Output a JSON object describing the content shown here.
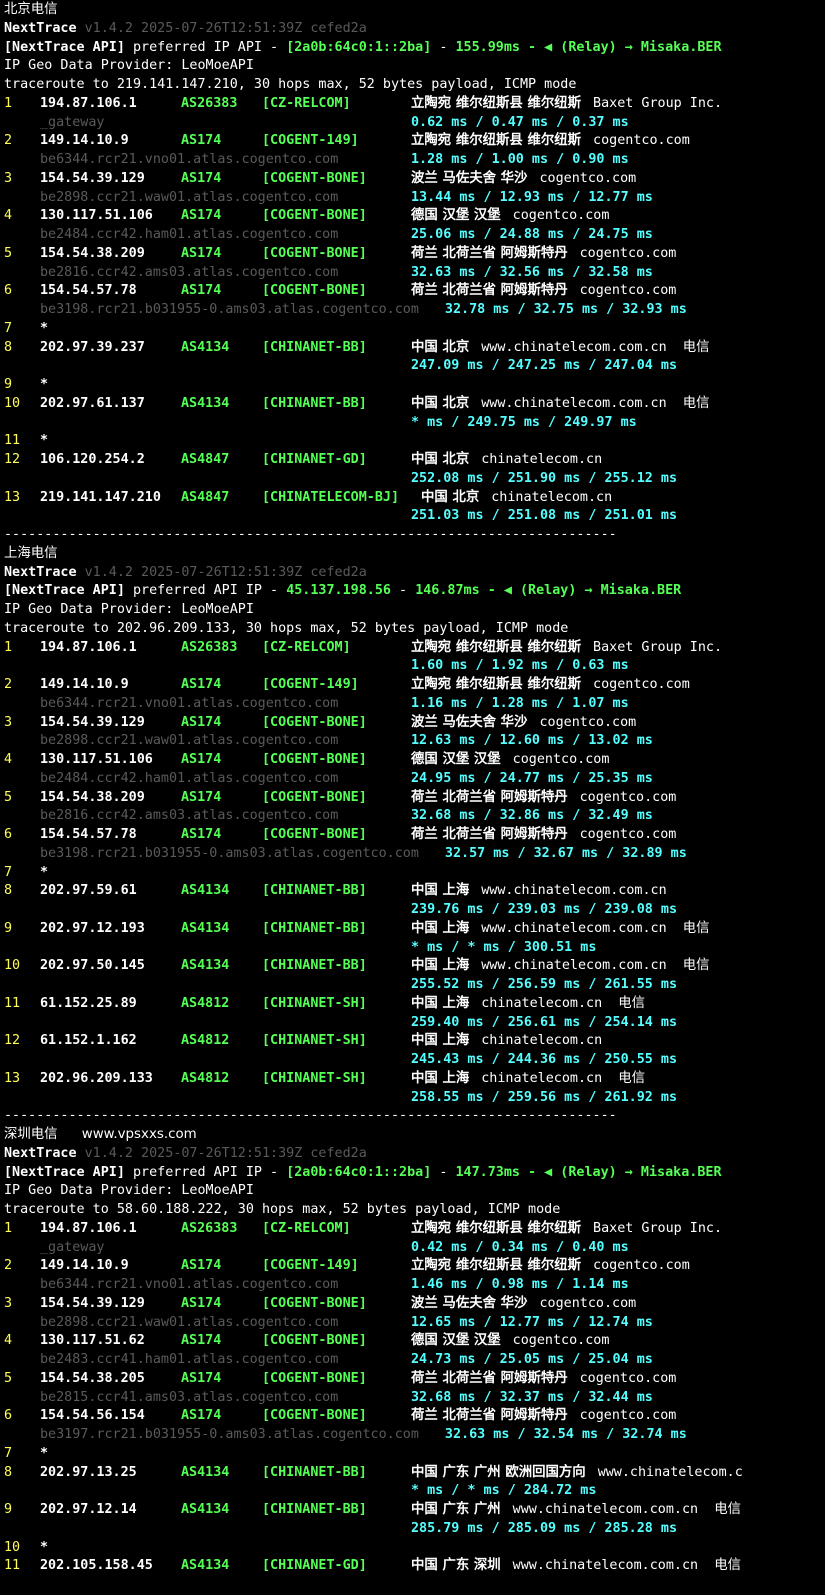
{
  "sections": [
    {
      "label": "北京电信",
      "header": {
        "name": "NextTrace",
        "version": "v1.4.2 2025-07-26T12:51:39Z cefed2a",
        "api_prefix": "[NextTrace API]",
        "api_text": " preferred IP API - ",
        "api_ip": "[2a0b:64c0:1::2ba]",
        "api_dash": " - ",
        "api_latency": "155.99ms",
        "api_relay": " - ◀ (Relay) → Misaka.BER",
        "geo": "IP Geo Data Provider: LeoMoeAPI",
        "trace": "traceroute to 219.141.147.210, 30 hops max, 52 bytes payload, ICMP mode"
      },
      "hops": [
        {
          "n": "1",
          "ip": "194.87.106.1",
          "as": "AS26383",
          "tag": "[CZ-RELCOM]",
          "geo": "立陶宛 维尔纽斯县 维尔纽斯",
          "org": "Baxet Group Inc.",
          "host": "_gateway",
          "rtt": "0.62 ms / 0.47 ms / 0.37 ms"
        },
        {
          "n": "2",
          "ip": "149.14.10.9",
          "as": "AS174",
          "tag": "[COGENT-149]",
          "geo": "立陶宛 维尔纽斯县 维尔纽斯",
          "org": "cogentco.com",
          "host": "be6344.rcr21.vno01.atlas.cogentco.com",
          "rtt": "1.28 ms / 1.00 ms / 0.90 ms"
        },
        {
          "n": "3",
          "ip": "154.54.39.129",
          "as": "AS174",
          "tag": "[COGENT-BONE]",
          "geo": "波兰 马佐夫舍 华沙",
          "org": "cogentco.com",
          "host": "be2898.ccr21.waw01.atlas.cogentco.com",
          "rtt": "13.44 ms / 12.93 ms / 12.77 ms"
        },
        {
          "n": "4",
          "ip": "130.117.51.106",
          "as": "AS174",
          "tag": "[COGENT-BONE]",
          "geo": "德国 汉堡 汉堡",
          "org": "cogentco.com",
          "host": "be2484.ccr42.ham01.atlas.cogentco.com",
          "rtt": "25.06 ms / 24.88 ms / 24.75 ms"
        },
        {
          "n": "5",
          "ip": "154.54.38.209",
          "as": "AS174",
          "tag": "[COGENT-BONE]",
          "geo": "荷兰 北荷兰省 阿姆斯特丹",
          "org": "cogentco.com",
          "host": "be2816.ccr42.ams03.atlas.cogentco.com",
          "rtt": "32.63 ms / 32.56 ms / 32.58 ms"
        },
        {
          "n": "6",
          "ip": "154.54.57.78",
          "as": "AS174",
          "tag": "[COGENT-BONE]",
          "geo": "荷兰 北荷兰省 阿姆斯特丹",
          "org": "cogentco.com",
          "host": "be3198.rcr21.b031955-0.ams03.atlas.cogentco.com",
          "rtt": "32.78 ms / 32.75 ms / 32.93 ms",
          "inline": true
        },
        {
          "n": "7",
          "star": true
        },
        {
          "n": "8",
          "ip": "202.97.39.237",
          "as": "AS4134",
          "tag": "[CHINANET-BB]",
          "geo": "中国 北京",
          "org": "www.chinatelecom.com.cn",
          "isp": "电信",
          "rtt": "247.09 ms / 247.25 ms / 247.04 ms"
        },
        {
          "n": "9",
          "star": true
        },
        {
          "n": "10",
          "ip": "202.97.61.137",
          "as": "AS4134",
          "tag": "[CHINANET-BB]",
          "geo": "中国 北京",
          "org": "www.chinatelecom.com.cn",
          "isp": "电信",
          "rtt": "* ms / 249.75 ms / 249.97 ms"
        },
        {
          "n": "11",
          "star": true
        },
        {
          "n": "12",
          "ip": "106.120.254.2",
          "as": "AS4847",
          "tag": "[CHINANET-GD]",
          "geo": "中国 北京",
          "org": "chinatelecom.cn",
          "rtt": "252.08 ms / 251.90 ms / 255.12 ms"
        },
        {
          "n": "13",
          "ip": "219.141.147.210",
          "as": "AS4847",
          "tag": "[CHINATELECOM-BJ]",
          "geo": "中国 北京",
          "org": "chinatelecom.cn",
          "rtt": "251.03 ms / 251.08 ms / 251.01 ms",
          "wide": true
        }
      ],
      "divider": "----------------------------------------------------------------------------"
    },
    {
      "label": "上海电信",
      "header": {
        "name": "NextTrace",
        "version": "v1.4.2 2025-07-26T12:51:39Z cefed2a",
        "api_prefix": "[NextTrace API]",
        "api_text": " preferred API IP - ",
        "api_ip": "45.137.198.56",
        "api_dash": " - ",
        "api_latency": "146.87ms",
        "api_relay": " - ◀ (Relay) → Misaka.BER",
        "geo": "IP Geo Data Provider: LeoMoeAPI",
        "trace": "traceroute to 202.96.209.133, 30 hops max, 52 bytes payload, ICMP mode"
      },
      "hops": [
        {
          "n": "1",
          "ip": "194.87.106.1",
          "as": "AS26383",
          "tag": "[CZ-RELCOM]",
          "geo": "立陶宛 维尔纽斯县 维尔纽斯",
          "org": "Baxet Group Inc.",
          "rtt": "1.60 ms / 1.92 ms / 0.63 ms"
        },
        {
          "n": "2",
          "ip": "149.14.10.9",
          "as": "AS174",
          "tag": "[COGENT-149]",
          "geo": "立陶宛 维尔纽斯县 维尔纽斯",
          "org": "cogentco.com",
          "host": "be6344.rcr21.vno01.atlas.cogentco.com",
          "rtt": "1.16 ms / 1.28 ms / 1.07 ms"
        },
        {
          "n": "3",
          "ip": "154.54.39.129",
          "as": "AS174",
          "tag": "[COGENT-BONE]",
          "geo": "波兰 马佐夫舍 华沙",
          "org": "cogentco.com",
          "host": "be2898.ccr21.waw01.atlas.cogentco.com",
          "rtt": "12.63 ms / 12.60 ms / 13.02 ms"
        },
        {
          "n": "4",
          "ip": "130.117.51.106",
          "as": "AS174",
          "tag": "[COGENT-BONE]",
          "geo": "德国 汉堡 汉堡",
          "org": "cogentco.com",
          "host": "be2484.ccr42.ham01.atlas.cogentco.com",
          "rtt": "24.95 ms / 24.77 ms / 25.35 ms"
        },
        {
          "n": "5",
          "ip": "154.54.38.209",
          "as": "AS174",
          "tag": "[COGENT-BONE]",
          "geo": "荷兰 北荷兰省 阿姆斯特丹",
          "org": "cogentco.com",
          "host": "be2816.ccr42.ams03.atlas.cogentco.com",
          "rtt": "32.68 ms / 32.86 ms / 32.49 ms"
        },
        {
          "n": "6",
          "ip": "154.54.57.78",
          "as": "AS174",
          "tag": "[COGENT-BONE]",
          "geo": "荷兰 北荷兰省 阿姆斯特丹",
          "org": "cogentco.com",
          "host": "be3198.rcr21.b031955-0.ams03.atlas.cogentco.com",
          "rtt": "32.57 ms / 32.67 ms / 32.89 ms",
          "inline": true
        },
        {
          "n": "7",
          "star": true
        },
        {
          "n": "8",
          "ip": "202.97.59.61",
          "as": "AS4134",
          "tag": "[CHINANET-BB]",
          "geo": "中国 上海",
          "org": "www.chinatelecom.com.cn",
          "rtt": "239.76 ms / 239.03 ms / 239.08 ms"
        },
        {
          "n": "9",
          "ip": "202.97.12.193",
          "as": "AS4134",
          "tag": "[CHINANET-BB]",
          "geo": "中国 上海",
          "org": "www.chinatelecom.com.cn",
          "isp": "电信",
          "rtt": "* ms / * ms / 300.51 ms"
        },
        {
          "n": "10",
          "ip": "202.97.50.145",
          "as": "AS4134",
          "tag": "[CHINANET-BB]",
          "geo": "中国 上海",
          "org": "www.chinatelecom.com.cn",
          "isp": "电信",
          "rtt": "255.52 ms / 256.59 ms / 261.55 ms"
        },
        {
          "n": "11",
          "ip": "61.152.25.89",
          "as": "AS4812",
          "tag": "[CHINANET-SH]",
          "geo": "中国 上海",
          "org": "chinatelecom.cn",
          "isp": "电信",
          "rtt": "259.40 ms / 256.61 ms / 254.14 ms"
        },
        {
          "n": "12",
          "ip": "61.152.1.162",
          "as": "AS4812",
          "tag": "[CHINANET-SH]",
          "geo": "中国 上海",
          "org": "chinatelecom.cn",
          "rtt": "245.43 ms / 244.36 ms / 250.55 ms"
        },
        {
          "n": "13",
          "ip": "202.96.209.133",
          "as": "AS4812",
          "tag": "[CHINANET-SH]",
          "geo": "中国 上海",
          "org": "chinatelecom.cn",
          "isp": "电信",
          "rtt": "258.55 ms / 259.56 ms / 261.92 ms"
        }
      ],
      "divider": "----------------------------------------------------------------------------"
    },
    {
      "label": "深圳电信",
      "watermark": "www.vpsxxs.com",
      "header": {
        "name": "NextTrace",
        "version": "v1.4.2 2025-07-26T12:51:39Z cefed2a",
        "api_prefix": "[NextTrace API]",
        "api_text": " preferred API IP - ",
        "api_ip": "[2a0b:64c0:1::2ba]",
        "api_dash": " - ",
        "api_latency": "147.73ms",
        "api_relay": " - ◀ (Relay) → Misaka.BER",
        "geo": "IP Geo Data Provider: LeoMoeAPI",
        "trace": "traceroute to 58.60.188.222, 30 hops max, 52 bytes payload, ICMP mode"
      },
      "hops": [
        {
          "n": "1",
          "ip": "194.87.106.1",
          "as": "AS26383",
          "tag": "[CZ-RELCOM]",
          "geo": "立陶宛 维尔纽斯县 维尔纽斯",
          "org": "Baxet Group Inc.",
          "host": "_gateway",
          "rtt": "0.42 ms / 0.34 ms / 0.40 ms"
        },
        {
          "n": "2",
          "ip": "149.14.10.9",
          "as": "AS174",
          "tag": "[COGENT-149]",
          "geo": "立陶宛 维尔纽斯县 维尔纽斯",
          "org": "cogentco.com",
          "host": "be6344.rcr21.vno01.atlas.cogentco.com",
          "rtt": "1.46 ms / 0.98 ms / 1.14 ms"
        },
        {
          "n": "3",
          "ip": "154.54.39.129",
          "as": "AS174",
          "tag": "[COGENT-BONE]",
          "geo": "波兰 马佐夫舍 华沙",
          "org": "cogentco.com",
          "host": "be2898.ccr21.waw01.atlas.cogentco.com",
          "rtt": "12.65 ms / 12.77 ms / 12.74 ms"
        },
        {
          "n": "4",
          "ip": "130.117.51.62",
          "as": "AS174",
          "tag": "[COGENT-BONE]",
          "geo": "德国 汉堡 汉堡",
          "org": "cogentco.com",
          "host": "be2483.ccr41.ham01.atlas.cogentco.com",
          "rtt": "24.73 ms / 25.05 ms / 25.04 ms"
        },
        {
          "n": "5",
          "ip": "154.54.38.205",
          "as": "AS174",
          "tag": "[COGENT-BONE]",
          "geo": "荷兰 北荷兰省 阿姆斯特丹",
          "org": "cogentco.com",
          "host": "be2815.ccr41.ams03.atlas.cogentco.com",
          "rtt": "32.68 ms / 32.37 ms / 32.44 ms"
        },
        {
          "n": "6",
          "ip": "154.54.56.154",
          "as": "AS174",
          "tag": "[COGENT-BONE]",
          "geo": "荷兰 北荷兰省 阿姆斯特丹",
          "org": "cogentco.com",
          "host": "be3197.rcr21.b031955-0.ams03.atlas.cogentco.com",
          "rtt": "32.63 ms / 32.54 ms / 32.74 ms",
          "inline": true
        },
        {
          "n": "7",
          "star": true
        },
        {
          "n": "8",
          "ip": "202.97.13.25",
          "as": "AS4134",
          "tag": "[CHINANET-BB]",
          "geo": "中国 广东 广州 欧洲回国方向",
          "org": "www.chinatelecom.c",
          "rtt": "* ms / * ms / 284.72 ms"
        },
        {
          "n": "9",
          "ip": "202.97.12.14",
          "as": "AS4134",
          "tag": "[CHINANET-BB]",
          "geo": "中国 广东 广州",
          "org": "www.chinatelecom.com.cn",
          "isp": "电信",
          "rtt": "285.79 ms / 285.09 ms / 285.28 ms"
        },
        {
          "n": "10",
          "star": true
        },
        {
          "n": "11",
          "ip": "202.105.158.45",
          "as": "AS4134",
          "tag": "[CHINANET-GD]",
          "geo": "中国 广东 深圳",
          "org": "www.chinatelecom.com.cn",
          "isp": "电信"
        }
      ]
    }
  ]
}
